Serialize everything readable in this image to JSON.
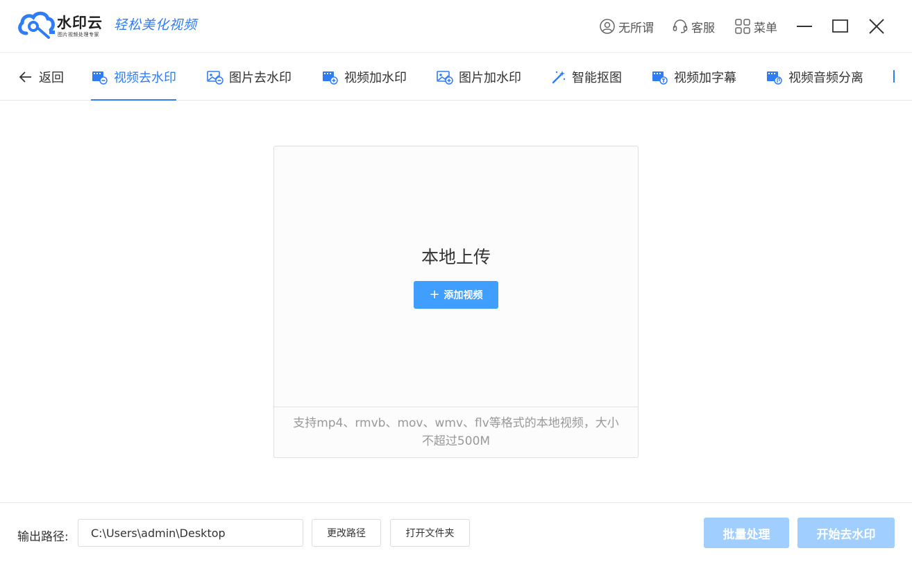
{
  "titlebar": {
    "logo_name": "水印云",
    "logo_subtitle": "图片视频处理专家",
    "logo_slogan": "轻松美化视频",
    "actions": [
      {
        "label": "无所谓",
        "icon": "user-icon"
      },
      {
        "label": "客服",
        "icon": "headset-icon"
      },
      {
        "label": "菜单",
        "icon": "grid-menu-icon"
      }
    ],
    "window_controls": [
      "minimize-icon",
      "maximize-icon",
      "close-icon"
    ]
  },
  "nav": {
    "back_label": "返回",
    "tabs": [
      {
        "label": "视频去水印",
        "icon": "video-remove-icon",
        "active": true
      },
      {
        "label": "图片去水印",
        "icon": "image-remove-icon",
        "active": false
      },
      {
        "label": "视频加水印",
        "icon": "video-add-icon",
        "active": false
      },
      {
        "label": "图片加水印",
        "icon": "image-add-icon",
        "active": false
      },
      {
        "label": "智能抠图",
        "icon": "magic-wand-icon",
        "active": false
      },
      {
        "label": "视频加字幕",
        "icon": "video-subtitle-icon",
        "active": false
      },
      {
        "label": "视频音频分离",
        "icon": "video-audio-icon",
        "active": false
      }
    ]
  },
  "upload": {
    "title": "本地上传",
    "button_label": "添加视频",
    "hint": "支持mp4、rmvb、mov、wmv、flv等格式的本地视频，大小不超过500M"
  },
  "footer": {
    "output_label": "输出路径:",
    "output_path": "C:\\Users\\admin\\Desktop",
    "change_path_label": "更改路径",
    "open_folder_label": "打开文件夹",
    "batch_label": "批量处理",
    "start_label": "开始去水印"
  },
  "colors": {
    "accent": "#2f7df6",
    "button_primary": "#409eff",
    "button_disabled": "#a0cfff"
  }
}
